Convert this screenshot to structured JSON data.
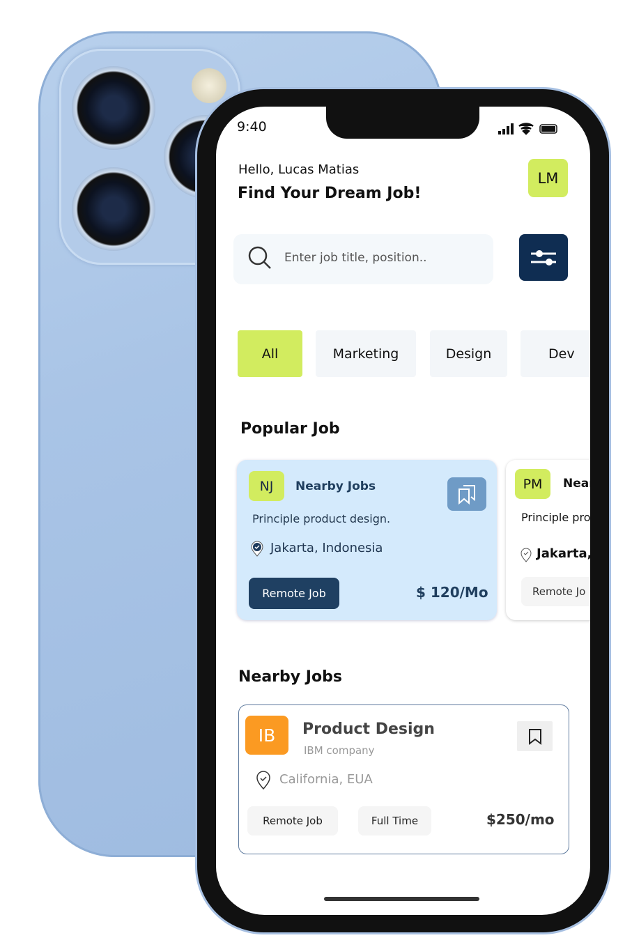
{
  "status": {
    "time": "9:40"
  },
  "header": {
    "greeting": "Hello, Lucas Matias",
    "title": "Find Your Dream Job!",
    "avatar": "LM"
  },
  "search": {
    "placeholder": "Enter job title, position.."
  },
  "categories": [
    {
      "label": "All",
      "active": true
    },
    {
      "label": "Marketing"
    },
    {
      "label": "Design"
    },
    {
      "label": "Dev"
    }
  ],
  "popular": {
    "title": "Popular Job",
    "cards": [
      {
        "initials": "NJ",
        "company": "Nearby Jobs",
        "role": "Principle product design.",
        "location": "Jakarta, Indonesia",
        "tag": "Remote Job",
        "salary": "$ 120/Mo"
      },
      {
        "initials": "PM",
        "company": "Near",
        "role": "Principle pro",
        "location": "Jakarta,",
        "tag": "Remote Jo"
      }
    ]
  },
  "nearby": {
    "title": "Nearby Jobs",
    "card": {
      "initials": "IB",
      "title": "Product Design",
      "company": "IBM company",
      "location": "California, EUA",
      "tags": [
        "Remote Job",
        "Full Time"
      ],
      "salary": "$250/mo"
    }
  },
  "colors": {
    "accent": "#d2ec5f",
    "navy": "#0f2d52",
    "card_blue": "#d4eafc",
    "orange": "#fb9a22"
  }
}
